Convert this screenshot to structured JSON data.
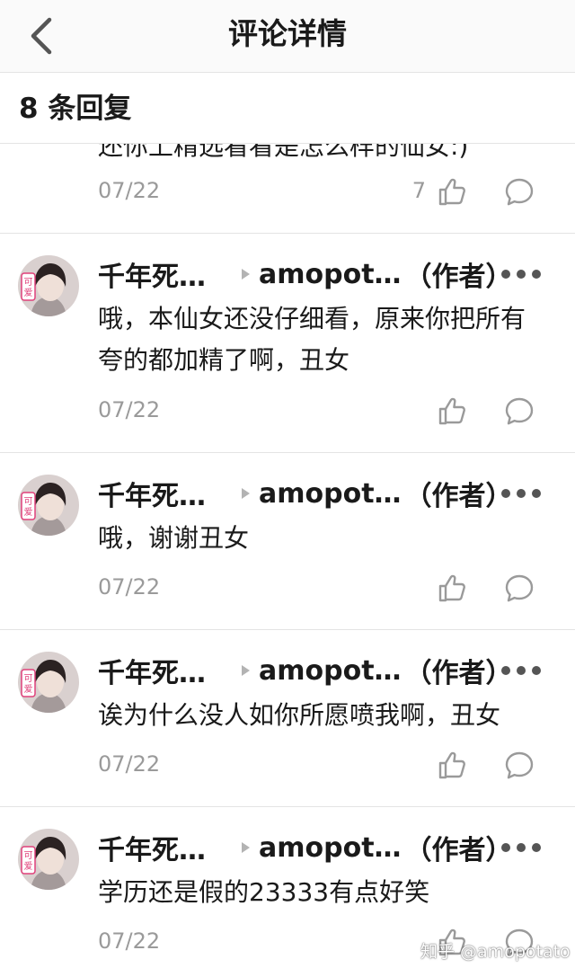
{
  "nav": {
    "title": "评论详情",
    "back_icon": "chevron-left-icon"
  },
  "replies": {
    "count_label": "8 条回复"
  },
  "partial_comment": {
    "text": "还你上精选看看是怎么样的仙女:)",
    "date": "07/22",
    "like_count": "7"
  },
  "comments": [
    {
      "author": "千年死…",
      "reply_to": "amopot…",
      "author_tag": "（作者）",
      "text": "哦，本仙女还没仔细看，原来你把所有夸的都加精了啊，丑女",
      "date": "07/22"
    },
    {
      "author": "千年死…",
      "reply_to": "amopot…",
      "author_tag": "（作者）",
      "text": "哦，谢谢丑女",
      "date": "07/22"
    },
    {
      "author": "千年死…",
      "reply_to": "amopot…",
      "author_tag": "（作者）",
      "text": "诶为什么没人如你所愿喷我啊，丑女",
      "date": "07/22"
    },
    {
      "author": "千年死…",
      "reply_to": "amopot…",
      "author_tag": "（作者）",
      "text": "学历还是假的23333有点好笑",
      "date": "07/22"
    }
  ],
  "avatar": {
    "badge_top": "可",
    "badge_bottom": "爱"
  },
  "icons": {
    "like": "thumbs-up-icon",
    "reply": "comment-bubble-icon",
    "more": "more-dots-icon"
  },
  "watermark": "知乎 @amopotato",
  "colors": {
    "text": "#1a1a1a",
    "muted": "#9a9a9a",
    "divider": "#e4e4e4",
    "badge": "#e0407a"
  }
}
